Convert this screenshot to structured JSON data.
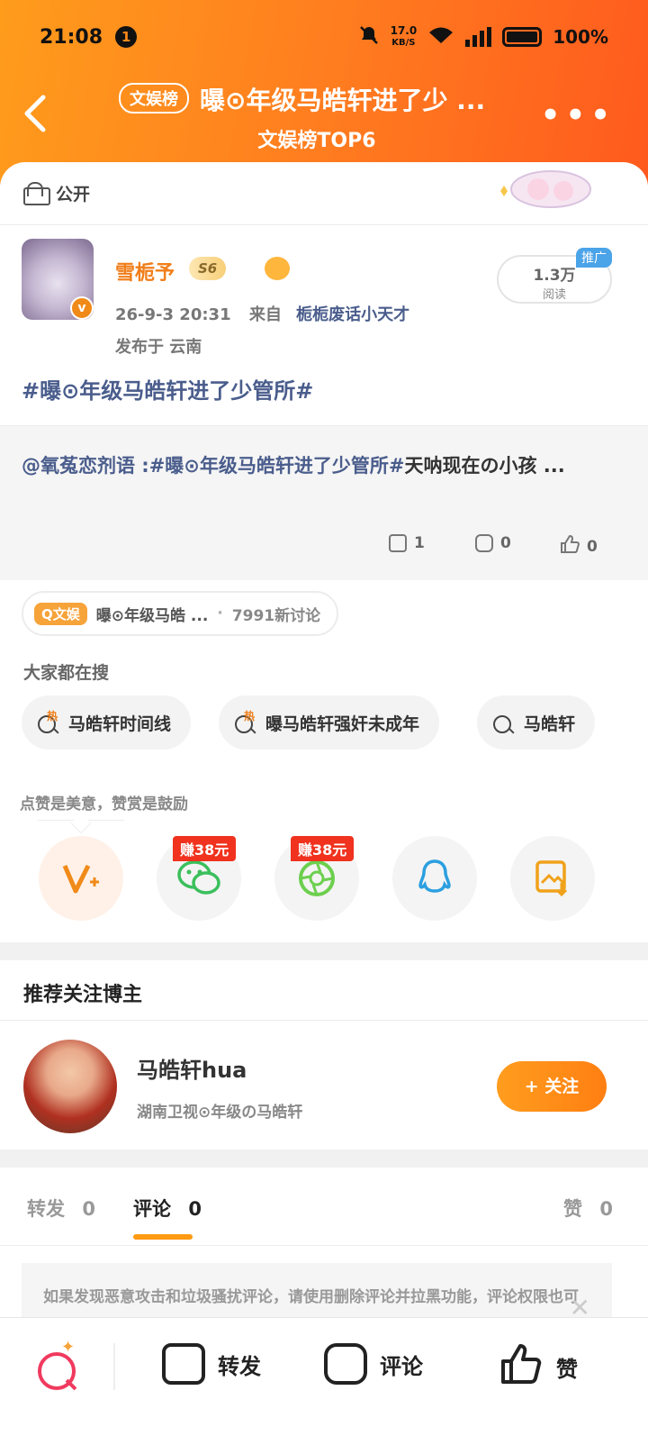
{
  "status": {
    "time": "21:08",
    "notif_count": "1",
    "speed_value": "17.0",
    "speed_unit": "KB/S",
    "battery": "100%"
  },
  "header": {
    "tag": "文娱榜",
    "title": "曝⊙年级马皓轩进了少 ...",
    "subtitle": "文娱榜TOP6"
  },
  "visibility": {
    "label": "公开"
  },
  "post": {
    "author": "雪栀予",
    "level": "S6",
    "time": "26-9-3 20:31",
    "from_label": "来自",
    "source": "栀栀废话小天才",
    "location": "发布于 云南",
    "reads_value": "1.3万",
    "reads_label": "阅读",
    "promo": "推广",
    "topic": "#曝⊙年级马皓轩进了少管所#"
  },
  "repost": {
    "mention": "@氧菟恋剂语 :#曝⊙年级马皓轩进了少管所#",
    "text": "天呐现在の小孩 ...",
    "share_count": "1",
    "comment_count": "0",
    "like_count": "0"
  },
  "search_tag": {
    "badge": "Q文娱",
    "title": "曝⊙年级马皓 ...",
    "dot": "·",
    "discussions": "7991新讨论"
  },
  "hot_search": {
    "heading": "大家都在搜",
    "hot_mark": "热",
    "items": [
      "马皓轩时间线",
      "曝马皓轩强奸未成年",
      "马皓轩"
    ]
  },
  "tip": {
    "heading": "点赞是美意，赞赏是鼓励",
    "earn1": "赚38元",
    "earn2": "赚38元"
  },
  "share_icons": [
    "vip-plus-icon",
    "wechat-icon",
    "moments-icon",
    "qq-icon",
    "save-image-icon"
  ],
  "recommend": {
    "heading": "推荐关注博主",
    "name": "马皓轩hua",
    "desc": "湖南卫视⊙年级の马皓轩",
    "follow": "+ 关注"
  },
  "tabs": [
    {
      "label": "转发",
      "count": "0"
    },
    {
      "label": "评论",
      "count": "0"
    },
    {
      "label": "赞",
      "count": "0"
    }
  ],
  "notice": {
    "text": "如果发现恶意攻击和垃圾骚扰评论，请使用删除评论并拉黑功能，评论权限也可根据情况开启数量控制等功能。"
  },
  "bottom": {
    "repost": "转发",
    "comment": "评论",
    "like": "赞"
  },
  "colors": {
    "accent": "#ff8a1c",
    "link": "#4a5d8c",
    "earn": "#f0321e"
  }
}
